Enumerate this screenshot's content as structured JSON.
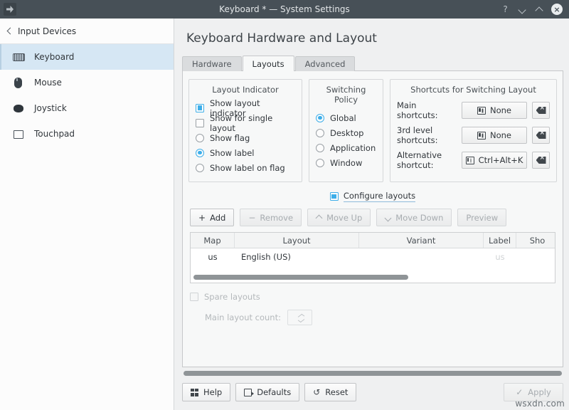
{
  "titlebar": {
    "title": "Keyboard * — System Settings",
    "help_label": "?",
    "minimize_label": "minimize",
    "maximize_label": "maximize",
    "close_label": "×",
    "bg_color": "#475057"
  },
  "sidebar": {
    "breadcrumb": "Input Devices",
    "items": [
      {
        "label": "Keyboard",
        "icon": "keyboard-icon",
        "selected": true
      },
      {
        "label": "Mouse",
        "icon": "mouse-icon",
        "selected": false
      },
      {
        "label": "Joystick",
        "icon": "joystick-icon",
        "selected": false
      },
      {
        "label": "Touchpad",
        "icon": "touchpad-icon",
        "selected": false
      }
    ],
    "selection_color": "#d6e7f4"
  },
  "main": {
    "page_title": "Keyboard Hardware and Layout",
    "tabs": [
      {
        "label": "Hardware",
        "active": false
      },
      {
        "label": "Layouts",
        "active": true
      },
      {
        "label": "Advanced",
        "active": false
      }
    ],
    "layout_indicator": {
      "title": "Layout Indicator",
      "options": [
        {
          "label": "Show layout indicator",
          "type": "checkbox",
          "checked": true
        },
        {
          "label": "Show for single layout",
          "type": "checkbox",
          "checked": false
        },
        {
          "label": "Show flag",
          "type": "radio",
          "checked": false
        },
        {
          "label": "Show label",
          "type": "radio",
          "checked": true
        },
        {
          "label": "Show label on flag",
          "type": "radio",
          "checked": false
        }
      ]
    },
    "switching_policy": {
      "title": "Switching Policy",
      "options": [
        {
          "label": "Global",
          "checked": true
        },
        {
          "label": "Desktop",
          "checked": false
        },
        {
          "label": "Application",
          "checked": false
        },
        {
          "label": "Window",
          "checked": false
        }
      ]
    },
    "shortcuts": {
      "title": "Shortcuts for Switching Layout",
      "rows": [
        {
          "label": "Main shortcuts:",
          "value": "None"
        },
        {
          "label": "3rd level shortcuts:",
          "value": "None"
        },
        {
          "label": "Alternative shortcut:",
          "value": "Ctrl+Alt+K"
        }
      ]
    },
    "configure_layouts": {
      "label": "Configure layouts",
      "checked": true
    },
    "actions": [
      {
        "label": "Add",
        "icon": "plus-icon",
        "enabled": true
      },
      {
        "label": "Remove",
        "icon": "minus-icon",
        "enabled": false
      },
      {
        "label": "Move Up",
        "icon": "caret-up-icon",
        "enabled": false
      },
      {
        "label": "Move Down",
        "icon": "caret-down-icon",
        "enabled": false
      },
      {
        "label": "Preview",
        "icon": "none",
        "enabled": false
      }
    ],
    "table": {
      "columns": [
        "Map",
        "Layout",
        "Variant",
        "Label",
        "Sho"
      ],
      "rows": [
        {
          "map": "us",
          "layout": "English (US)",
          "variant": "",
          "label": "us",
          "shortcut": ""
        }
      ],
      "hscroll_percent": 60
    },
    "spare_layouts": {
      "label": "Spare layouts",
      "checked": false,
      "enabled": false
    },
    "main_layout_count": {
      "label": "Main layout count:",
      "value": "",
      "enabled": false
    }
  },
  "footer": {
    "buttons": [
      {
        "label": "Help",
        "icon": "help-icon",
        "enabled": true
      },
      {
        "label": "Defaults",
        "icon": "defaults-icon",
        "enabled": true
      },
      {
        "label": "Reset",
        "icon": "reset-icon",
        "enabled": true
      }
    ],
    "apply": {
      "label": "Apply",
      "icon": "check-icon",
      "enabled": false
    }
  },
  "watermark": "wsxdn.com",
  "theme": {
    "accent": "#3daee9",
    "window_bg": "#eff0f1",
    "panel_bg": "#f7f8f8"
  }
}
